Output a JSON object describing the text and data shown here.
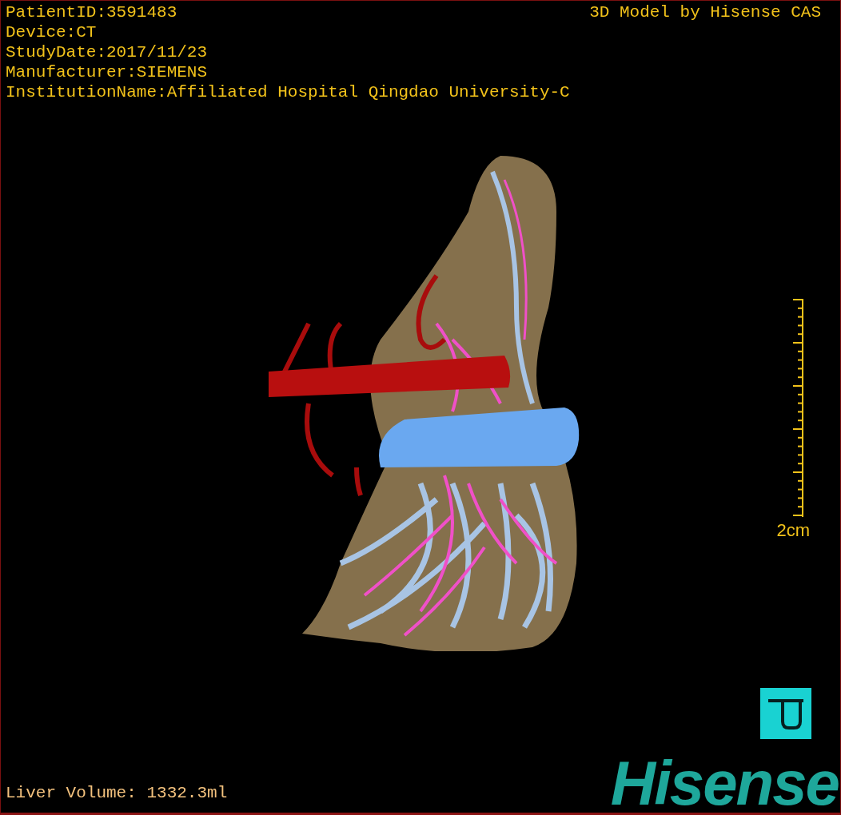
{
  "study_info": [
    "PatientID:3591483",
    "Device:CT",
    "StudyDate:2017/11/23",
    "Manufacturer:SIEMENS",
    "InstitutionName:Affiliated Hospital Qingdao University-C"
  ],
  "model_credit": "3D Model by Hisense CAS",
  "scale_bar": {
    "label": "2cm"
  },
  "liver_volume": "Liver Volume: 1332.3ml",
  "logo": "Hisense"
}
